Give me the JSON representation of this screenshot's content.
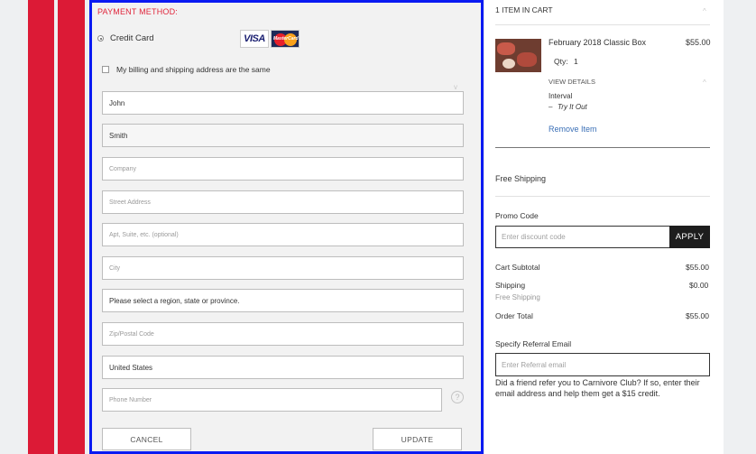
{
  "payment": {
    "section_label": "PAYMENT METHOD:",
    "method_label": "Credit Card",
    "visa_label": "VISA",
    "mastercard_label": "MasterCard",
    "same_address_label": "My billing and shipping address are the same"
  },
  "form": {
    "first_name": "John",
    "last_name": "Smith",
    "company_placeholder": "Company",
    "street_placeholder": "Street Address",
    "apt_placeholder": "Apt, Suite, etc. (optional)",
    "city_placeholder": "City",
    "region_value": "Please select a region, state or province.",
    "zip_placeholder": "Zip/Postal Code",
    "country_value": "United States",
    "phone_placeholder": "Phone Number",
    "help_glyph": "?",
    "cancel_label": "CANCEL",
    "update_label": "UPDATE"
  },
  "cart": {
    "header": "1 ITEM IN CART",
    "item": {
      "name": "February 2018 Classic Box",
      "price": "$55.00",
      "qty_label": "Qty:",
      "qty_value": "1",
      "view_details": "VIEW DETAILS",
      "option_label": "Interval",
      "option_dash": "–",
      "option_value": "Try It Out",
      "remove_label": "Remove Item"
    },
    "free_shipping": "Free Shipping",
    "promo_label": "Promo Code",
    "promo_placeholder": "Enter discount code",
    "apply_label": "APPLY",
    "subtotal_label": "Cart Subtotal",
    "subtotal_value": "$55.00",
    "shipping_label": "Shipping",
    "shipping_value": "$0.00",
    "shipping_method": "Free Shipping",
    "total_label": "Order Total",
    "total_value": "$55.00",
    "referral_label": "Specify Referral Email",
    "referral_placeholder": "Enter Referral email",
    "referral_note": "Did a friend refer you to Carnivore Club? If so, enter their email address and help them get a $15 credit."
  },
  "icons": {
    "chevron_up": "^",
    "chevron_down": "v"
  },
  "colors": {
    "brand_red": "#dc1a36",
    "focus_blue": "#0a1af2",
    "link_blue": "#3a6fb6"
  }
}
